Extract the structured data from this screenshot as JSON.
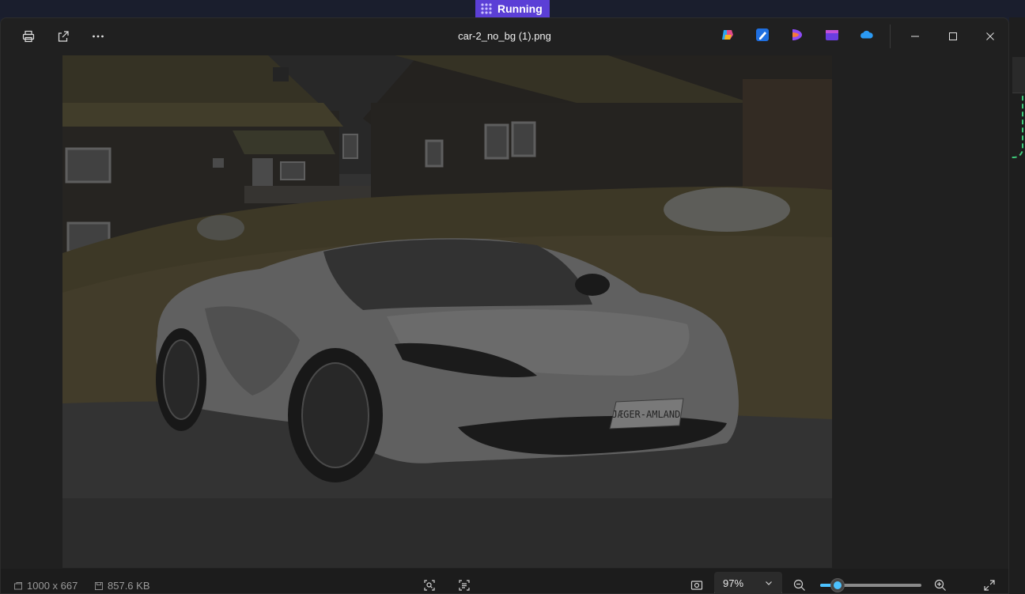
{
  "taskbar": {
    "running_label": "Running"
  },
  "window": {
    "title": "car-2_no_bg (1).png"
  },
  "toolbar": {
    "print": "print-icon",
    "share": "share-icon",
    "more": "more-icon"
  },
  "apps": [
    "copilot-icon",
    "designer-icon",
    "clipchamp-icon",
    "video-editor-icon",
    "onedrive-icon"
  ],
  "image": {
    "plate_text": "JÆGER-AMLAND"
  },
  "status": {
    "dimensions": "1000 x 667",
    "file_size": "857.6 KB",
    "zoom": "97%",
    "zoom_fraction": 0.17
  },
  "colors": {
    "accent": "#4cc2ff",
    "running_badge": "#5b3fd6"
  }
}
